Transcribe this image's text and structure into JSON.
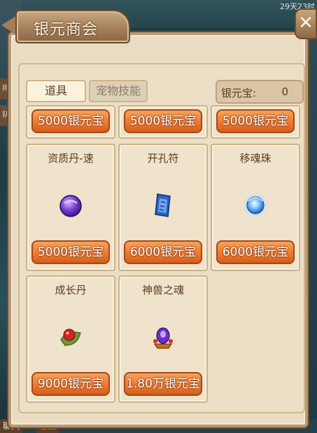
{
  "hud": {
    "clock": "29天23时",
    "side_tabs": [
      "排",
      "队"
    ],
    "bottom_buttons": [
      "聊天",
      "帮派"
    ]
  },
  "header": {
    "title": "银元商会",
    "close_icon": "close-x-icon"
  },
  "tabs": [
    {
      "label": "道具",
      "active": true
    },
    {
      "label": "宠物技能",
      "active": false
    }
  ],
  "currency": {
    "label": "银元宝:",
    "value": "0"
  },
  "top_row_prices": [
    "5000银元宝",
    "5000银元宝",
    "5000银元宝"
  ],
  "items": [
    {
      "name": "资质丹-速",
      "icon": "purple-orb-icon",
      "price": "5000银元宝"
    },
    {
      "name": "开孔符",
      "icon": "blue-talisman-icon",
      "price": "6000银元宝"
    },
    {
      "name": "移魂珠",
      "icon": "blue-glowing-orb-icon",
      "price": "6000银元宝"
    },
    {
      "name": "成长丹",
      "icon": "red-pill-leaf-icon",
      "price": "9000银元宝"
    },
    {
      "name": "神兽之魂",
      "icon": "beast-soul-gem-icon",
      "price": "1.80万银元宝"
    }
  ],
  "colors": {
    "panel_bg": "#e9dcc3",
    "price_button": "#ec7a2f",
    "frame": "#b89a72"
  }
}
